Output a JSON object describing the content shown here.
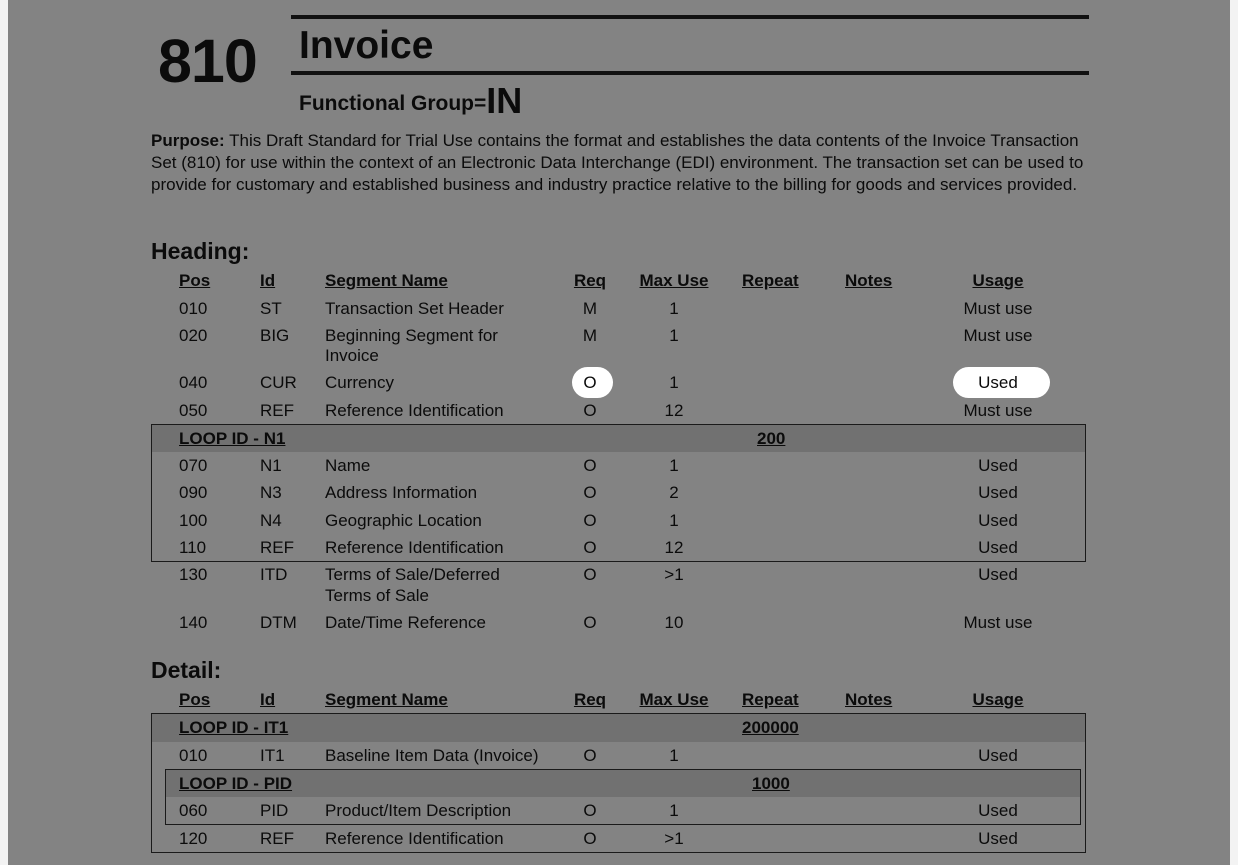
{
  "header": {
    "number": "810",
    "title": "Invoice",
    "functional_group_label": "Functional Group=",
    "functional_group_value": "IN"
  },
  "purpose": {
    "label": "Purpose:",
    "text": "This Draft Standard for Trial Use contains the format and establishes the data contents of the Invoice Transaction Set (810) for use within the context of an Electronic Data Interchange (EDI) environment. The transaction set can be used to provide for customary and established business and industry practice relative to the billing for goods and services provided."
  },
  "columns": {
    "pos": "Pos",
    "id": "Id",
    "name": "Segment Name",
    "req": "Req",
    "max": "Max Use",
    "repeat": "Repeat",
    "notes": "Notes",
    "usage": "Usage"
  },
  "heading": {
    "title": "Heading:",
    "rows": [
      {
        "pos": "010",
        "id": "ST",
        "name": "Transaction Set Header",
        "req": "M",
        "max": "1",
        "usage": "Must use"
      },
      {
        "pos": "020",
        "id": "BIG",
        "name": "Beginning Segment for",
        "name2": "Invoice",
        "req": "M",
        "max": "1",
        "usage": "Must use"
      },
      {
        "pos": "040",
        "id": "CUR",
        "name": "Currency",
        "req": "O",
        "max": "1",
        "usage": "Used"
      },
      {
        "pos": "050",
        "id": "REF",
        "name": "Reference Identification",
        "req": "O",
        "max": "12",
        "usage": "Must use"
      },
      {
        "pos": "070",
        "id": "N1",
        "name": "Name",
        "req": "O",
        "max": "1",
        "usage": "Used"
      },
      {
        "pos": "090",
        "id": "N3",
        "name": "Address Information",
        "req": "O",
        "max": "2",
        "usage": "Used"
      },
      {
        "pos": "100",
        "id": "N4",
        "name": "Geographic Location",
        "req": "O",
        "max": "1",
        "usage": "Used"
      },
      {
        "pos": "110",
        "id": "REF",
        "name": "Reference Identification",
        "req": "O",
        "max": "12",
        "usage": "Used"
      },
      {
        "pos": "130",
        "id": "ITD",
        "name": "Terms of Sale/Deferred",
        "name2": "Terms of Sale",
        "req": "O",
        "max": ">1",
        "usage": "Used"
      },
      {
        "pos": "140",
        "id": "DTM",
        "name": "Date/Time Reference",
        "req": "O",
        "max": "10",
        "usage": "Must use"
      }
    ],
    "loop_n1": {
      "label": "LOOP ID - N1",
      "repeat": "200"
    }
  },
  "detail": {
    "title": "Detail:",
    "loop_it1": {
      "label": "LOOP ID - IT1",
      "repeat": "200000"
    },
    "loop_pid": {
      "label": "LOOP ID - PID",
      "repeat": "1000"
    },
    "rows": [
      {
        "pos": "010",
        "id": "IT1",
        "name": "Baseline Item Data (Invoice)",
        "req": "O",
        "max": "1",
        "usage": "Used"
      },
      {
        "pos": "060",
        "id": "PID",
        "name": "Product/Item Description",
        "req": "O",
        "max": "1",
        "usage": "Used"
      },
      {
        "pos": "120",
        "id": "REF",
        "name": "Reference Identification",
        "req": "O",
        "max": ">1",
        "usage": "Used"
      }
    ]
  },
  "colors": {
    "page_bg": "#838383",
    "loop_band": "#717171",
    "highlight": "#ffffff"
  }
}
